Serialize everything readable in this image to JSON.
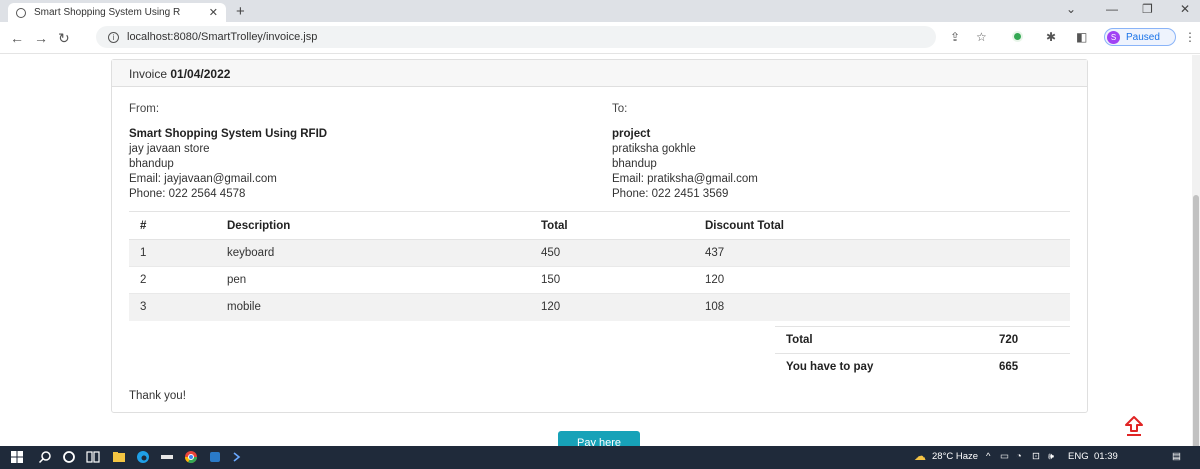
{
  "browser": {
    "tab_title": "Smart Shopping System Using R",
    "url": "localhost:8080/SmartTrolley/invoice.jsp",
    "profile_initial": "S",
    "profile_status": "Paused"
  },
  "invoice": {
    "label": "Invoice",
    "date": "01/04/2022",
    "from": {
      "label": "From:",
      "name": "Smart Shopping System Using RFID",
      "line1": "jay javaan store",
      "line2": "bhandup",
      "email": "Email: jayjavaan@gmail.com",
      "phone": "Phone: 022 2564 4578"
    },
    "to": {
      "label": "To:",
      "name": "project",
      "line1": "pratiksha gokhle",
      "line2": "bhandup",
      "email": "Email: pratiksha@gmail.com",
      "phone": "Phone: 022 2451 3569"
    },
    "columns": [
      "#",
      "Description",
      "Total",
      "Discount Total"
    ],
    "items": [
      {
        "no": "1",
        "description": "keyboard",
        "total": "450",
        "discount_total": "437"
      },
      {
        "no": "2",
        "description": "pen",
        "total": "150",
        "discount_total": "120"
      },
      {
        "no": "3",
        "description": "mobile",
        "total": "120",
        "discount_total": "108"
      }
    ],
    "summary": {
      "total_label": "Total",
      "total_value": "720",
      "pay_label": "You have to pay",
      "pay_value": "665"
    },
    "thanks": "Thank you!"
  },
  "actions": {
    "pay_button": "Pay here"
  },
  "taskbar": {
    "weather": "28°C Haze",
    "language": "ENG",
    "time": "01:39"
  },
  "colors": {
    "pay_button": "#17a2b8",
    "scroll_top_arrow": "#e02424",
    "taskbar": "#1f2a3a"
  }
}
